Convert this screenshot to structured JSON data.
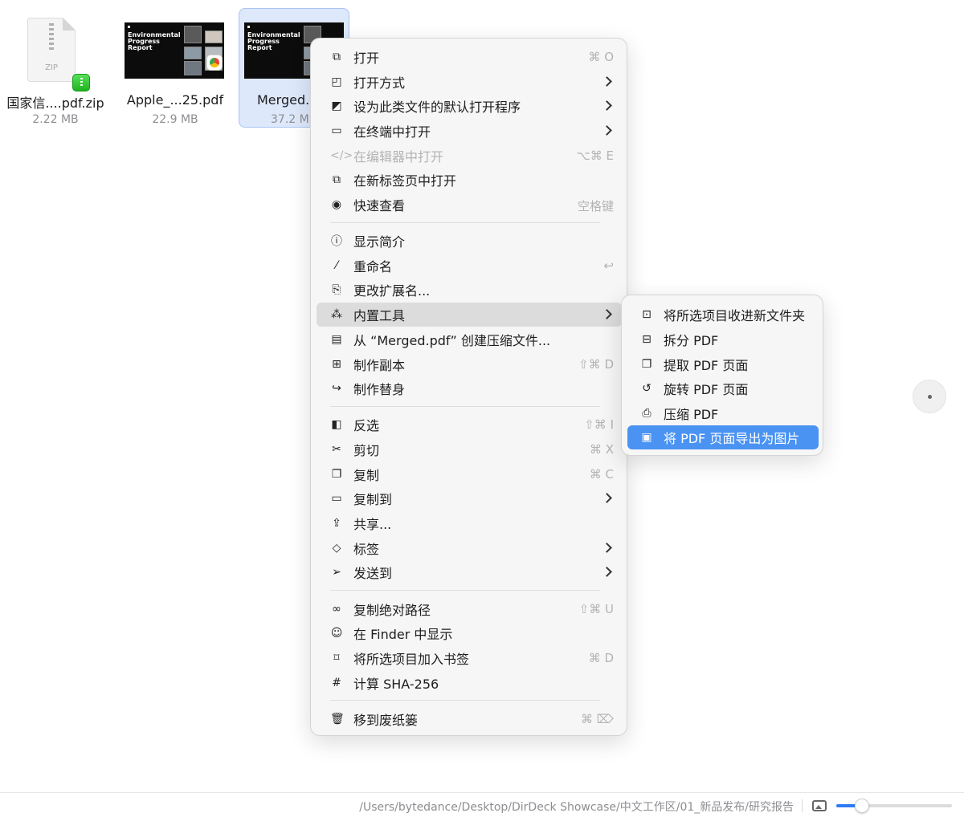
{
  "files": [
    {
      "name": "国家信....pdf.zip",
      "size": "2.22 MB",
      "thumb_label": "ZIP",
      "selected": false
    },
    {
      "name": "Apple_...25.pdf",
      "size": "22.9 MB",
      "thumb_title": "Environmental Progress Report",
      "selected": false
    },
    {
      "name": "Merged.pdf",
      "size": "37.2 MB",
      "thumb_title": "Environmental Progress Report",
      "selected": true
    }
  ],
  "context_menu": {
    "items": [
      {
        "icon": "open-icon",
        "label": "打开",
        "shortcut": "⌘ O"
      },
      {
        "icon": "open-with-icon",
        "label": "打开方式",
        "submenu": true
      },
      {
        "icon": "default-app-icon",
        "label": "设为此类文件的默认打开程序",
        "submenu": true
      },
      {
        "icon": "terminal-icon",
        "label": "在终端中打开",
        "submenu": true
      },
      {
        "icon": "code-icon",
        "label": "在编辑器中打开",
        "shortcut": "⌥⌘ E",
        "disabled": true
      },
      {
        "icon": "new-tab-icon",
        "label": "在新标签页中打开"
      },
      {
        "icon": "eye-icon",
        "label": "快速查看",
        "shortcut": "空格键"
      },
      {
        "icon": "info-icon",
        "label": "显示简介"
      },
      {
        "icon": "pencil-icon",
        "label": "重命名",
        "shortcut": "↩"
      },
      {
        "icon": "rename-extension-icon",
        "label": "更改扩展名..."
      },
      {
        "icon": "magic-wand-icon",
        "label": "内置工具",
        "submenu": true,
        "hover": true
      },
      {
        "icon": "archive-icon",
        "label": "从 “Merged.pdf” 创建压缩文件..."
      },
      {
        "icon": "duplicate-icon",
        "label": "制作副本",
        "shortcut": "⇧⌘ D"
      },
      {
        "icon": "alias-icon",
        "label": "制作替身"
      },
      {
        "icon": "invert-selection-icon",
        "label": "反选",
        "shortcut": "⇧⌘ I"
      },
      {
        "icon": "scissors-icon",
        "label": "剪切",
        "shortcut": "⌘ X"
      },
      {
        "icon": "copy-icon",
        "label": "复制",
        "shortcut": "⌘ C"
      },
      {
        "icon": "folder-icon",
        "label": "复制到",
        "submenu": true
      },
      {
        "icon": "share-icon",
        "label": "共享..."
      },
      {
        "icon": "tag-icon",
        "label": "标签",
        "submenu": true
      },
      {
        "icon": "send-icon",
        "label": "发送到",
        "submenu": true
      },
      {
        "icon": "link-icon",
        "label": "复制绝对路径",
        "shortcut": "⇧⌘ U"
      },
      {
        "icon": "finder-icon",
        "label": "在 Finder 中显示"
      },
      {
        "icon": "bookmark-icon",
        "label": "将所选项目加入书签",
        "shortcut": "⌘ D"
      },
      {
        "icon": "hash-icon",
        "label": "计算 SHA-256"
      },
      {
        "icon": "trash-icon",
        "label": "移到废纸篓",
        "shortcut": "⌘ ⌦"
      }
    ]
  },
  "submenu": {
    "items": [
      {
        "icon": "new-folder-icon",
        "label": "将所选项目收进新文件夹"
      },
      {
        "icon": "split-icon",
        "label": "拆分 PDF"
      },
      {
        "icon": "extract-pages-icon",
        "label": "提取 PDF 页面"
      },
      {
        "icon": "rotate-icon",
        "label": "旋转 PDF 页面"
      },
      {
        "icon": "compress-icon",
        "label": "压缩 PDF"
      },
      {
        "icon": "export-image-icon",
        "label": "将 PDF 页面导出为图片",
        "active": true
      }
    ]
  },
  "statusbar": {
    "path": "/Users/bytedance/Desktop/DirDeck Showcase/中文工作区/01_新品发布/研究报告",
    "thumbnail_size_level": 0.22
  },
  "colors": {
    "accent": "#4a93f3",
    "selection_bg": "#dde8fb",
    "slider_fill": "#2f7cf6"
  }
}
